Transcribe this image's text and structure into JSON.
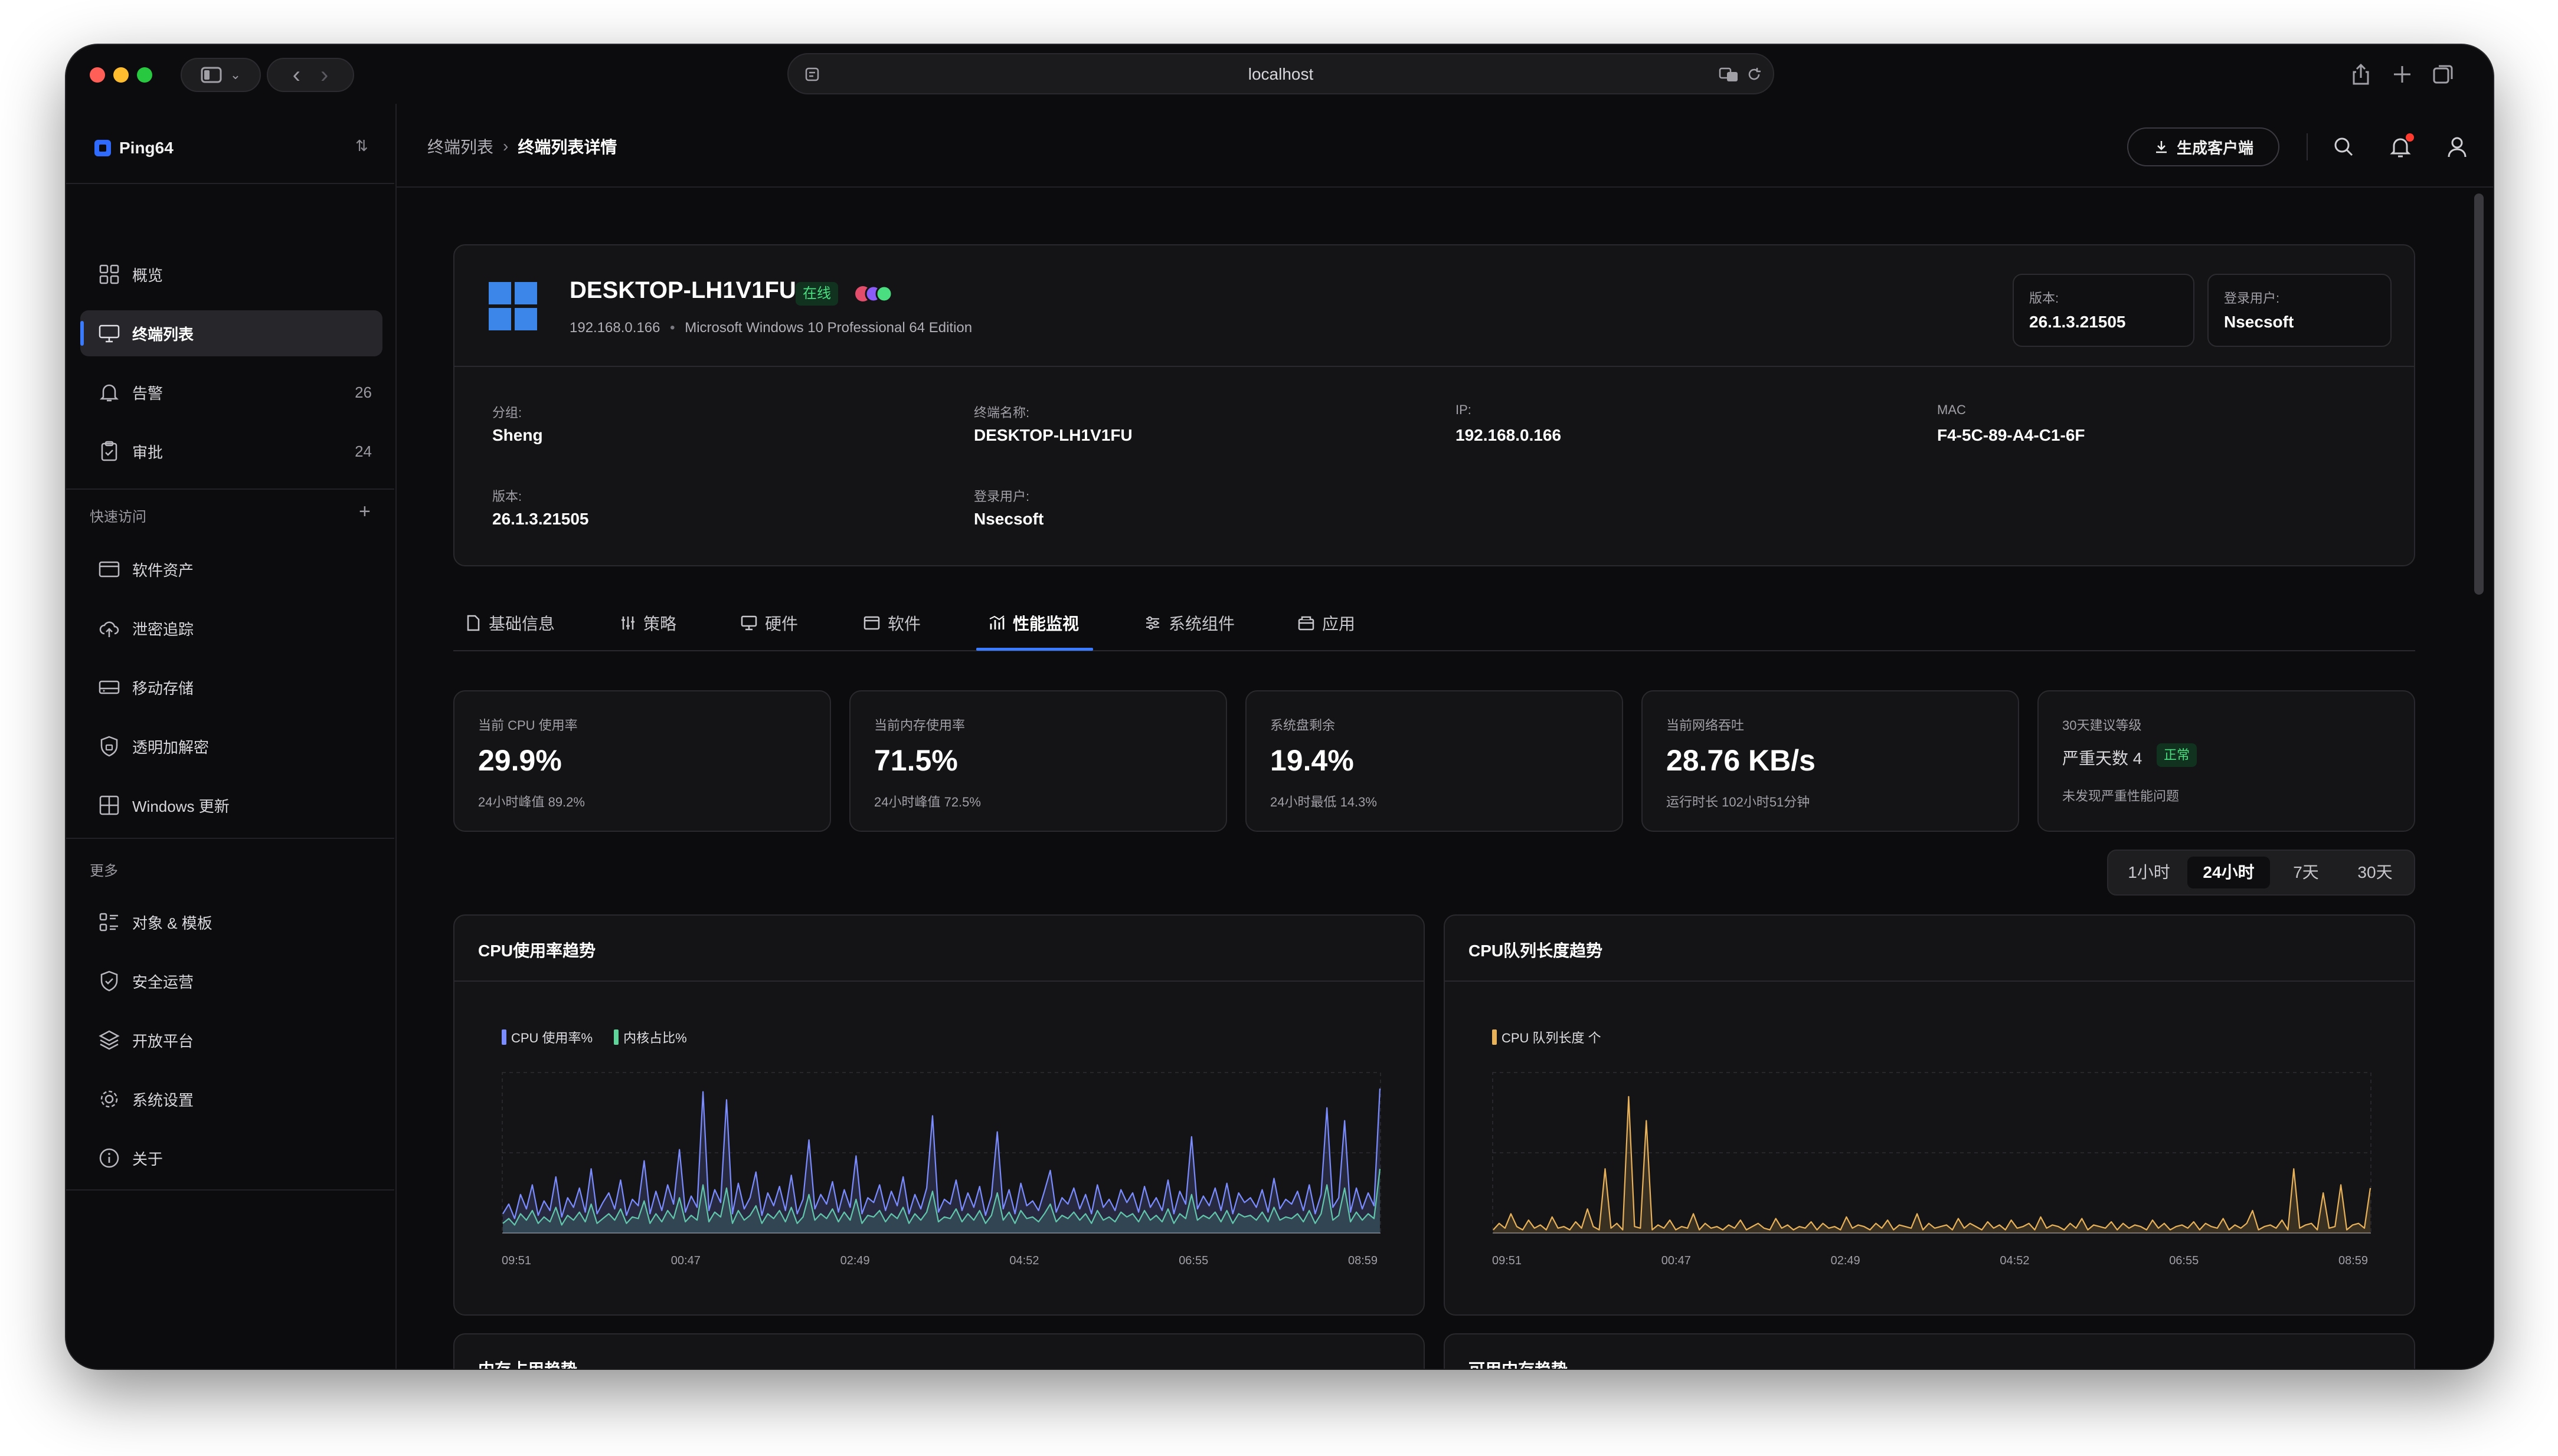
{
  "browser": {
    "url": "localhost"
  },
  "sidebar": {
    "brand": "Ping64",
    "nav": [
      {
        "label": "概览",
        "count": ""
      },
      {
        "label": "终端列表",
        "count": ""
      },
      {
        "label": "告警",
        "count": "26"
      },
      {
        "label": "审批",
        "count": "24"
      }
    ],
    "quick_label": "快速访问",
    "quick": [
      {
        "label": "软件资产"
      },
      {
        "label": "泄密追踪"
      },
      {
        "label": "移动存储"
      },
      {
        "label": "透明加解密"
      },
      {
        "label": "Windows 更新"
      }
    ],
    "more_label": "更多",
    "more": [
      {
        "label": "对象 & 模板"
      },
      {
        "label": "安全运营"
      },
      {
        "label": "开放平台"
      },
      {
        "label": "系统设置"
      },
      {
        "label": "关于"
      }
    ]
  },
  "header": {
    "breadcrumb": [
      "终端列表",
      "终端列表详情"
    ],
    "generate_button": "生成客户端"
  },
  "device": {
    "name": "DESKTOP-LH1V1FU",
    "status": "在线",
    "ip": "192.168.0.166",
    "os": "Microsoft Windows 10 Professional 64 Edition",
    "version_label": "版本:",
    "version": "26.1.3.21505",
    "user_label": "登录用户:",
    "user": "Nsecsoft",
    "info": [
      {
        "key": "分组:",
        "value": "Sheng"
      },
      {
        "key": "终端名称:",
        "value": "DESKTOP-LH1V1FU"
      },
      {
        "key": "IP:",
        "value": "192.168.0.166"
      },
      {
        "key": "MAC",
        "value": "F4-5C-89-A4-C1-6F"
      },
      {
        "key": "版本:",
        "value": "26.1.3.21505"
      },
      {
        "key": "登录用户:",
        "value": "Nsecsoft"
      }
    ]
  },
  "tabs": [
    {
      "label": "基础信息",
      "icon": "file-icon"
    },
    {
      "label": "策略",
      "icon": "sliders-icon"
    },
    {
      "label": "硬件",
      "icon": "monitor-icon"
    },
    {
      "label": "软件",
      "icon": "window-icon"
    },
    {
      "label": "性能监视",
      "icon": "chart-icon",
      "active": true
    },
    {
      "label": "系统组件",
      "icon": "settings-icon"
    },
    {
      "label": "应用",
      "icon": "package-icon"
    }
  ],
  "stats": [
    {
      "key": "当前 CPU 使用率",
      "value": "29.9%",
      "sub": "24小时峰值 89.2%"
    },
    {
      "key": "当前内存使用率",
      "value": "71.5%",
      "sub": "24小时峰值 72.5%"
    },
    {
      "key": "系统盘剩余",
      "value": "19.4%",
      "sub": "24小时最低 14.3%"
    },
    {
      "key": "当前网络吞吐",
      "value": "28.76 KB/s",
      "sub": "运行时长 102小时51分钟"
    },
    {
      "key": "30天建议等级",
      "value": "严重天数 4",
      "badge": "正常",
      "sub": "未发现严重性能问题"
    }
  ],
  "time_range": {
    "options": [
      "1小时",
      "24小时",
      "7天",
      "30天"
    ],
    "selected": "24小时"
  },
  "colors": {
    "accent": "#3b7bff",
    "cpu": "#7b8cff",
    "kernel": "#5fd39a",
    "queue": "#e8b25a",
    "online": "#4ade80"
  },
  "charts_below": [
    "内存占用趋势",
    "可用内存趋势"
  ],
  "chart_data": [
    {
      "type": "line",
      "title": "CPU使用率趋势",
      "x_ticks": [
        "09:51",
        "00:47",
        "02:49",
        "04:52",
        "06:55",
        "08:59"
      ],
      "ylim": [
        0,
        100
      ],
      "series": [
        {
          "name": "CPU 使用率%",
          "values": [
            12,
            18,
            9,
            24,
            15,
            30,
            11,
            20,
            14,
            35,
            10,
            22,
            16,
            28,
            13,
            40,
            12,
            19,
            25,
            15,
            33,
            11,
            21,
            17,
            45,
            12,
            26,
            14,
            30,
            18,
            52,
            13,
            23,
            16,
            88,
            14,
            27,
            19,
            83,
            12,
            31,
            15,
            22,
            38,
            11,
            25,
            17,
            29,
            14,
            36,
            12,
            21,
            58,
            15,
            24,
            18,
            32,
            13,
            27,
            16,
            48,
            12,
            22,
            19,
            30,
            14,
            26,
            17,
            35,
            12,
            24,
            15,
            28,
            73,
            13,
            21,
            18,
            33,
            14,
            25,
            16,
            29,
            11,
            23,
            63,
            15,
            27,
            12,
            31,
            17,
            20,
            14,
            26,
            39,
            13,
            22,
            18,
            28,
            15,
            24,
            12,
            30,
            16,
            21,
            14,
            27,
            19,
            25,
            13,
            29,
            16,
            22,
            14,
            33,
            12,
            26,
            18,
            60,
            15,
            23,
            17,
            28,
            14,
            31,
            12,
            25,
            19,
            22,
            16,
            27,
            13,
            34,
            15,
            21,
            18,
            26,
            14,
            30,
            12,
            24,
            78,
            16,
            22,
            70,
            13,
            28,
            15,
            25,
            17,
            90
          ]
        },
        {
          "name": "内核占比%",
          "values": [
            6,
            9,
            5,
            12,
            8,
            14,
            6,
            10,
            7,
            16,
            5,
            11,
            8,
            13,
            7,
            18,
            6,
            9,
            12,
            8,
            15,
            6,
            10,
            9,
            20,
            6,
            12,
            7,
            14,
            9,
            22,
            7,
            11,
            8,
            30,
            7,
            13,
            10,
            28,
            6,
            14,
            8,
            11,
            17,
            6,
            12,
            9,
            14,
            7,
            16,
            6,
            10,
            24,
            8,
            12,
            9,
            15,
            7,
            13,
            8,
            21,
            6,
            11,
            10,
            14,
            7,
            12,
            9,
            16,
            6,
            12,
            8,
            13,
            26,
            7,
            10,
            9,
            15,
            7,
            12,
            8,
            14,
            6,
            11,
            25,
            8,
            13,
            6,
            14,
            9,
            10,
            7,
            12,
            18,
            7,
            11,
            9,
            13,
            8,
            12,
            6,
            14,
            8,
            10,
            7,
            13,
            10,
            12,
            7,
            14,
            8,
            11,
            7,
            15,
            6,
            12,
            9,
            24,
            8,
            11,
            9,
            13,
            7,
            14,
            6,
            12,
            10,
            11,
            8,
            13,
            7,
            16,
            8,
            10,
            9,
            12,
            7,
            14,
            6,
            12,
            30,
            8,
            11,
            28,
            7,
            13,
            8,
            12,
            9,
            40
          ]
        }
      ]
    },
    {
      "type": "line",
      "title": "CPU队列长度趋势",
      "x_ticks": [
        "09:51",
        "00:47",
        "02:49",
        "04:52",
        "06:55",
        "08:59"
      ],
      "ylim": [
        0,
        100
      ],
      "series": [
        {
          "name": "CPU 队列长度 个",
          "values": [
            2,
            6,
            3,
            12,
            4,
            2,
            8,
            3,
            5,
            2,
            10,
            3,
            4,
            2,
            7,
            3,
            15,
            4,
            2,
            40,
            3,
            6,
            2,
            85,
            4,
            3,
            70,
            2,
            5,
            3,
            8,
            2,
            4,
            3,
            12,
            2,
            6,
            3,
            4,
            2,
            5,
            3,
            8,
            2,
            4,
            6,
            3,
            2,
            9,
            3,
            5,
            2,
            4,
            3,
            7,
            2,
            6,
            3,
            4,
            2,
            10,
            3,
            5,
            4,
            2,
            6,
            3,
            8,
            2,
            5,
            4,
            3,
            12,
            2,
            6,
            3,
            4,
            5,
            2,
            9,
            3,
            6,
            4,
            2,
            7,
            3,
            5,
            2,
            8,
            3,
            4,
            6,
            2,
            10,
            3,
            5,
            4,
            2,
            6,
            3,
            9,
            2,
            5,
            4,
            3,
            7,
            2,
            6,
            3,
            5,
            4,
            2,
            8,
            3,
            6,
            2,
            4,
            5,
            3,
            7,
            2,
            6,
            4,
            3,
            9,
            2,
            5,
            3,
            6,
            14,
            2,
            4,
            5,
            3,
            8,
            2,
            40,
            3,
            5,
            6,
            2,
            25,
            3,
            4,
            30,
            2,
            5,
            6,
            3,
            28
          ]
        }
      ]
    }
  ]
}
